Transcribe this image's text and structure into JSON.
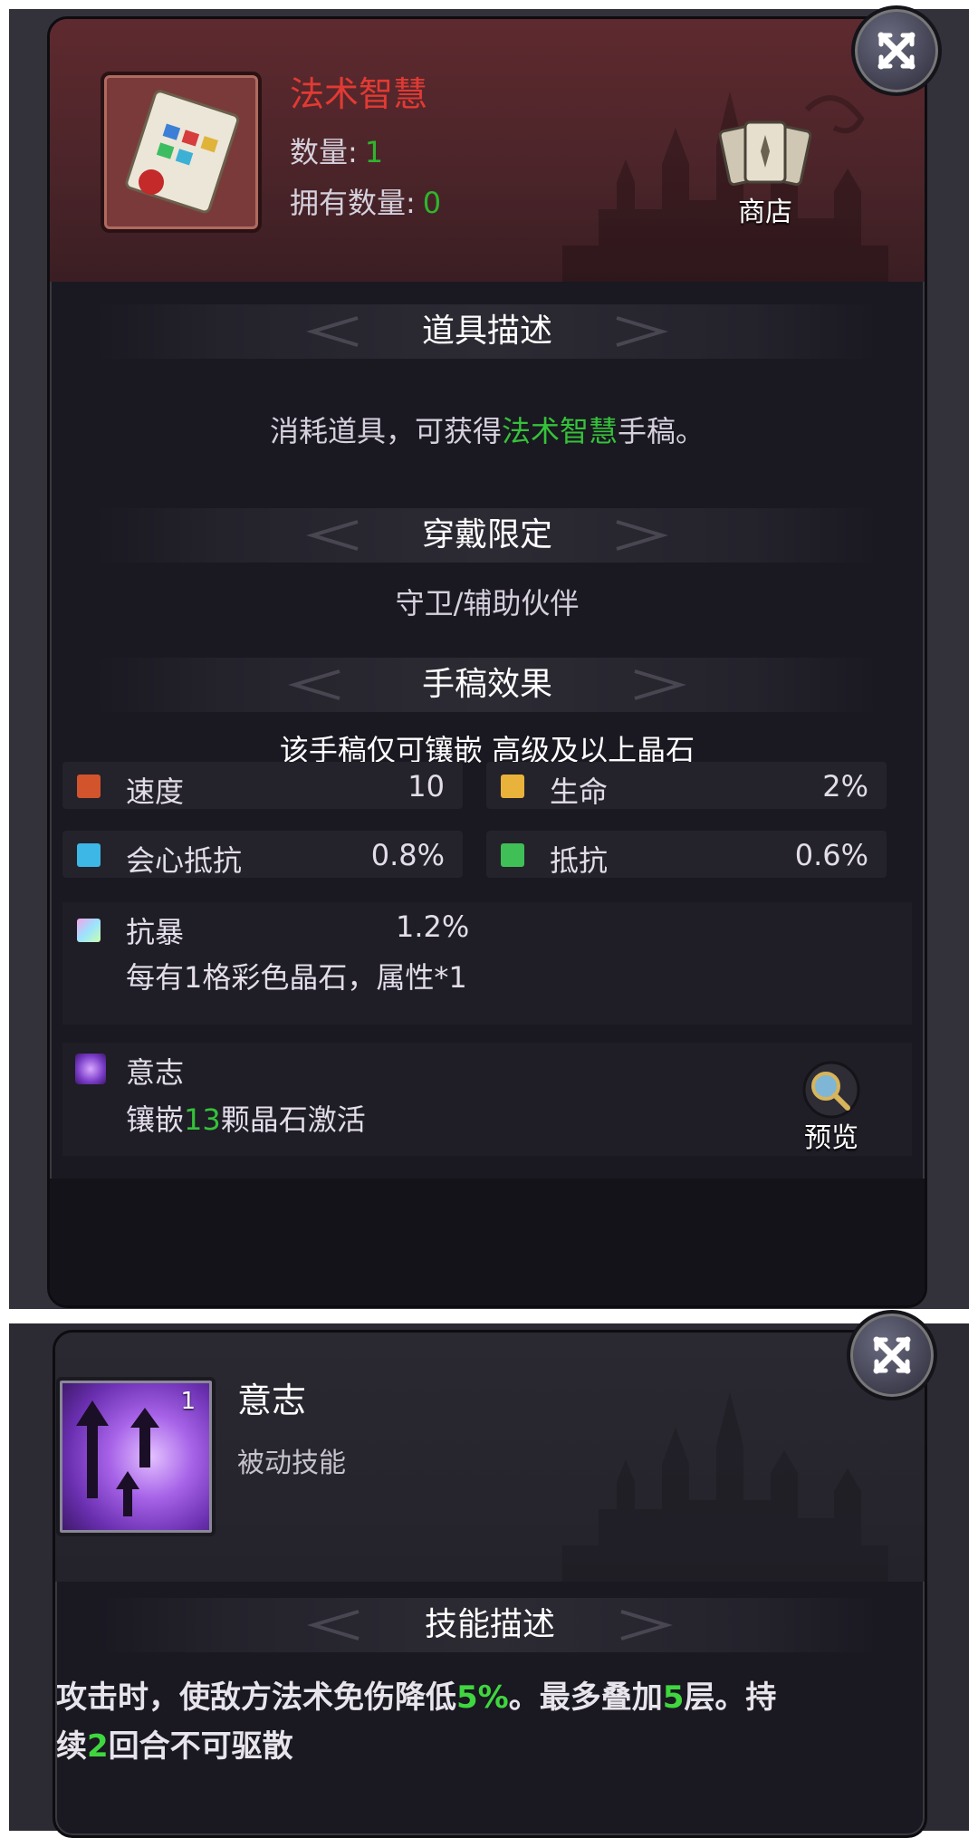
{
  "item": {
    "name": "法术智慧",
    "quantity_label": "数量:",
    "quantity_value": "1",
    "owned_label": "拥有数量:",
    "owned_value": "0",
    "shop_label": "商店"
  },
  "sections": {
    "item_desc_title": "道具描述",
    "item_desc_pre": "消耗道具，可获得",
    "item_desc_highlight": "法术智慧",
    "item_desc_post": "手稿。",
    "wear_limit_title": "穿戴限定",
    "wear_limit_text": "守卫/辅助伙伴",
    "effect_title": "手稿效果",
    "effect_note": "该手稿仅可镶嵌 高级及以上晶石"
  },
  "stats": [
    {
      "label": "速度",
      "value": "10",
      "gem_color": "#d2542c"
    },
    {
      "label": "生命",
      "value": "2%",
      "gem_color": "#e9b23a"
    },
    {
      "label": "会心抵抗",
      "value": "0.8%",
      "gem_color": "#3db7e6"
    },
    {
      "label": "抵抗",
      "value": "0.6%",
      "gem_color": "#3fbf55"
    }
  ],
  "rainbow_stat": {
    "label": "抗暴",
    "value": "1.2%",
    "note": "每有1格彩色晶石，属性*1"
  },
  "will_stat": {
    "label": "意志",
    "note_pre": "镶嵌",
    "note_highlight": "13",
    "note_post": "颗晶石激活",
    "preview_label": "预览"
  },
  "skill": {
    "level": "1",
    "name": "意志",
    "type": "被动技能",
    "desc_title": "技能描述",
    "desc_1": "攻击时，使敌方法术免伤降低",
    "desc_2": "5%",
    "desc_3": "。最多叠加",
    "desc_4": "5",
    "desc_5": "层。持",
    "desc_6": "续",
    "desc_7": "2",
    "desc_8": "回合不可驱散"
  }
}
